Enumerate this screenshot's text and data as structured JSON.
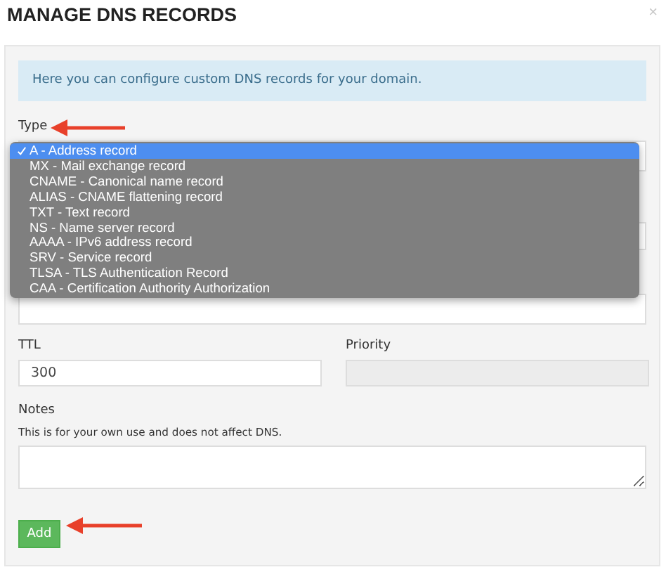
{
  "dialog": {
    "title": "MANAGE DNS RECORDS",
    "close": "×"
  },
  "info": "Here you can configure custom DNS records for your domain.",
  "type_field": {
    "label": "Type",
    "options": [
      {
        "label": "A - Address record",
        "selected": true
      },
      {
        "label": "MX - Mail exchange record",
        "selected": false
      },
      {
        "label": "CNAME - Canonical name record",
        "selected": false
      },
      {
        "label": "ALIAS - CNAME flattening record",
        "selected": false
      },
      {
        "label": "TXT - Text record",
        "selected": false
      },
      {
        "label": "NS - Name server record",
        "selected": false
      },
      {
        "label": "AAAA - IPv6 address record",
        "selected": false
      },
      {
        "label": "SRV - Service record",
        "selected": false
      },
      {
        "label": "TLSA - TLS Authentication Record",
        "selected": false
      },
      {
        "label": "CAA - Certification Authority Authorization",
        "selected": false
      }
    ]
  },
  "ttl": {
    "label": "TTL",
    "value": "300"
  },
  "priority": {
    "label": "Priority",
    "disabled": true
  },
  "notes": {
    "label": "Notes",
    "help": "This is for your own use and does not affect DNS."
  },
  "add_button": "Add"
}
